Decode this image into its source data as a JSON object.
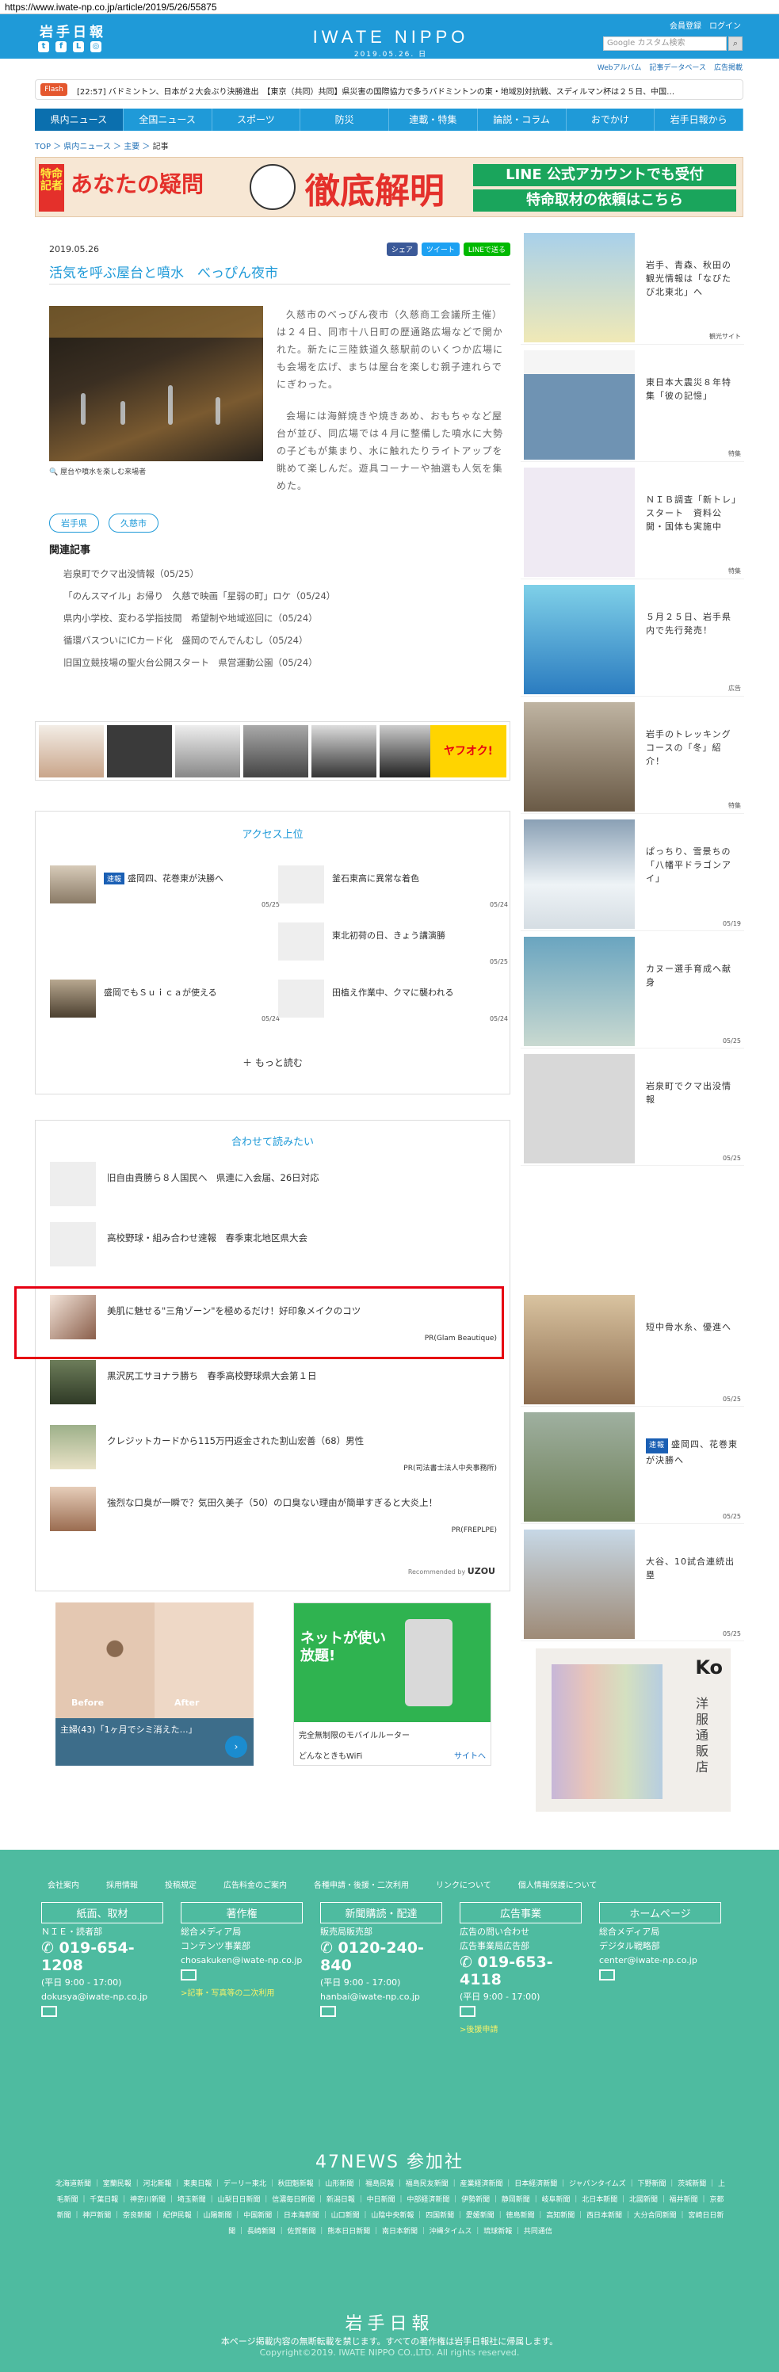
{
  "browser": {
    "url": "https://www.iwate-np.co.jp/article/2019/5/26/55875"
  },
  "header": {
    "logo_small": "岩手日報",
    "brand_name": "IWATE NIPPO",
    "brand_date": "2019.05.26. 日",
    "member_link": "会員登録",
    "login_link": "ログイン",
    "search_placeholder": "Google カスタム検索",
    "sublinks": [
      "Webアルバム",
      "記事データベース",
      "広告掲載"
    ]
  },
  "flash": {
    "label": "Flash",
    "text": "[22:57] バドミントン、日本が２大会ぶり決勝進出　【東京（共同）共同】県災害の国際協力で多うバドミントンの東・地域別対抗戦、スディルマン杯は２５日、中国…"
  },
  "nav": {
    "items": [
      "県内ニュース",
      "全国ニュース",
      "スポーツ",
      "防災",
      "連載・特集",
      "論説・コラム",
      "おでかけ",
      "岩手日報から"
    ]
  },
  "breadcrumb": [
    "TOP",
    "県内ニュース",
    "主要",
    "記事"
  ],
  "banner": {
    "tag": "特命記者",
    "text1": "あなたの疑問",
    "text2": "徹底解明",
    "line1": "LINE 公式アカウントでも受付",
    "line2": "特命取材の依頼はこちら"
  },
  "article": {
    "date": "2019.05.26",
    "share": [
      "シェア",
      "ツイート",
      "LINEで送る"
    ],
    "title": "活気を呼ぶ屋台と噴水　べっぴん夜市",
    "caption": "屋台や噴水を楽しむ来場者",
    "p1": "久慈市のべっぴん夜市（久慈商工会議所主催）は２４日、同市十八日町の歴通路広場などで開かれた。新たに三陸鉄道久慈駅前のいくつか広場にも会場を広げ、まちは屋台を楽しむ親子連れらでにぎわった。",
    "p2": "会場には海鮮焼きや焼きあめ、おもちゃなど屋台が並び、同広場では４月に整備した噴水に大勢の子どもが集まり、水に触れたりライトアップを眺めて楽しんだ。遊具コーナーや抽選も人気を集めた。",
    "tags": [
      "岩手県",
      "久慈市"
    ],
    "related_heading": "関連記事",
    "related": [
      "岩泉町でクマ出没情報（05/25）",
      "「のんスマイル」お帰り　久慈で映画「星弱の町」ロケ（05/24）",
      "県内小学校、変わる学指技間　希望制や地域巡回に（05/24）",
      "循環バスついにICカード化　盛岡のでんでんむし（05/24）",
      "旧国立競技場の聖火台公開スタート　県営運動公園（05/24）"
    ]
  },
  "ad_yahoo": {
    "label": "ヤフオク!"
  },
  "access": {
    "heading": "アクセス上位",
    "items": [
      {
        "badge": "速報",
        "title": "盛岡四、花巻東が決勝へ",
        "date": "05/25"
      },
      {
        "badge": "",
        "title": "釜石東高に異常な着色",
        "date": "05/24"
      },
      {
        "badge": "",
        "title": "東北初荷の日、きょう講演勝",
        "date": "05/25"
      },
      {
        "badge": "",
        "title": "盛岡でもＳｕｉｃａが使える",
        "date": "05/24"
      },
      {
        "badge": "",
        "title": "田植え作業中、クマに襲われる",
        "date": "05/24"
      }
    ],
    "more": "もっと読む"
  },
  "recommend": {
    "heading": "合わせて読みたい",
    "items": [
      {
        "title": "旧自由貴勝ら８人国民へ　県連に入会届、26日対応",
        "pr": ""
      },
      {
        "title": "高校野球・組み合わせ速報　春季東北地区県大会",
        "pr": ""
      },
      {
        "title": "美肌に魅せる\"三角ゾーン\"を極めるだけ！好印象メイクのコツ",
        "pr": "PR(Glam Beautique)"
      },
      {
        "title": "黒沢尻工サヨナラ勝ち　春季高校野球県大会第１日",
        "pr": ""
      },
      {
        "title": "クレジットカードから115万円返金された割山宏善（68）男性",
        "pr": "PR(司法書士法人中央事務所)"
      },
      {
        "title": "強烈な口臭が一瞬で？気田久美子（50）の口臭ない理由が簡単すぎると大炎上！",
        "pr": "PR(FREPLPE)"
      }
    ],
    "recommended_by": "Recommended by",
    "vendor": "UZOU"
  },
  "ads_bottom": {
    "before": "Before",
    "after": "After",
    "ad1_text": "主婦(43)「1ヶ月でシミ消えた…」",
    "ad2_top": "ネットが使い放題!",
    "ad2_mid": "完全無制限のモバイルルーター",
    "ad2_bot": "どんなときもWiFi",
    "ad2_site": "サイトへ",
    "ad3_logo": "Ko",
    "ad3_text": "洋服通販店"
  },
  "sidebar": {
    "items": [
      {
        "title": "岩手、青森、秋田の観光情報は「なびたび北東北」へ",
        "date": "観光サイト"
      },
      {
        "title": "東日本大震災８年特集「彼の記憶」",
        "date": "特集"
      },
      {
        "title": "ＮＩＢ調査「新トレ」スタート　資料公開・国体も実施中",
        "date": "特集"
      },
      {
        "title": "５月２５日、岩手県内で先行発売！",
        "date": "広告"
      },
      {
        "title": "岩手のトレッキングコースの「冬」紹介！",
        "date": "特集"
      },
      {
        "title": "ぱっちり、雪景ちの「八幡平ドラゴンアイ」",
        "date": "05/19"
      },
      {
        "title": "カヌー選手育成へ献身",
        "date": "05/25"
      },
      {
        "title": "岩泉町でクマ出没情報",
        "date": "05/25"
      },
      {
        "title": "短中骨水糸、優進へ",
        "date": "05/25"
      },
      {
        "badge": "速報",
        "title": "盛岡四、花巻東が決勝へ",
        "date": "05/25"
      },
      {
        "title": "大谷、10試合連続出塁",
        "date": "05/25"
      }
    ]
  },
  "footer": {
    "links": [
      "会社案内",
      "採用情報",
      "投稿規定",
      "広告料金のご案内",
      "各種申請・後援・二次利用",
      "リンクについて",
      "個人情報保護について"
    ],
    "cols": [
      {
        "head": "紙面、取材",
        "l1": "ＮＩＥ・読者部",
        "tel": "019-654-1208",
        "l2": "(平日 9:00 - 17:00)",
        "mail": "dokusya@iwate-np.co.jp",
        "extra": ""
      },
      {
        "head": "著作権",
        "l1": "総合メディア局",
        "tel": "",
        "l2": "コンテンツ事業部",
        "mail": "chosakuken@iwate-np.co.jp",
        "extra": ">記事・写真等の二次利用"
      },
      {
        "head": "新聞購読・配達",
        "l1": "販売局販売部",
        "tel": "0120-240-840",
        "l2": "(平日 9:00 - 17:00)",
        "mail": "hanbai@iwate-np.co.jp",
        "extra": ""
      },
      {
        "head": "広告事業",
        "l1": "広告の問い合わせ",
        "tel": "019-653-4118",
        "l2": "広告事業局広告部",
        "mail": "(平日 9:00 - 17:00)",
        "extra": ">後援申請"
      },
      {
        "head": "ホームページ",
        "l1": "総合メディア局",
        "tel": "",
        "l2": "デジタル戦略部",
        "mail": "center@iwate-np.co.jp",
        "extra": ""
      }
    ],
    "news47": "47NEWS 参加社",
    "news47_list": "北海道新聞 ｜ 室蘭民報 ｜ 河北新報 ｜ 東奥日報 ｜ デーリー東北 ｜ 秋田魁新報 ｜ 山形新聞 ｜ 福島民報 ｜ 福島民友新聞 ｜ 産業経済新聞 ｜ 日本経済新聞 ｜ ジャパンタイムズ ｜ 下野新聞 ｜ 茨城新聞 ｜ 上毛新聞 ｜ 千葉日報 ｜ 神奈川新聞 ｜ 埼玉新聞 ｜ 山梨日日新聞 ｜ 信濃毎日新聞 ｜ 新潟日報 ｜ 中日新聞 ｜ 中部経済新聞 ｜ 伊勢新聞 ｜ 静岡新聞 ｜ 岐阜新聞 ｜ 北日本新聞 ｜ 北國新聞 ｜ 福井新聞 ｜ 京都新聞 ｜ 神戸新聞 ｜ 奈良新聞 ｜ 紀伊民報 ｜ 山陽新聞 ｜ 中国新聞 ｜ 日本海新聞 ｜ 山口新聞 ｜ 山陰中央新報 ｜ 四国新聞 ｜ 愛媛新聞 ｜ 徳島新聞 ｜ 高知新聞 ｜ 西日本新聞 ｜ 大分合同新聞 ｜ 宮崎日日新聞 ｜ 長崎新聞 ｜ 佐賀新聞 ｜ 熊本日日新聞 ｜ 南日本新聞 ｜ 沖縄タイムス ｜ 琉球新報 ｜ 共同通信",
    "logo": "岩手日報",
    "note": "本ページ掲載内容の無断転載を禁じます。すべての著作権は岩手日報社に帰属します。",
    "copyright": "Copyright©2019. IWATE NIPPO CO.,LTD. All rights reserved."
  }
}
